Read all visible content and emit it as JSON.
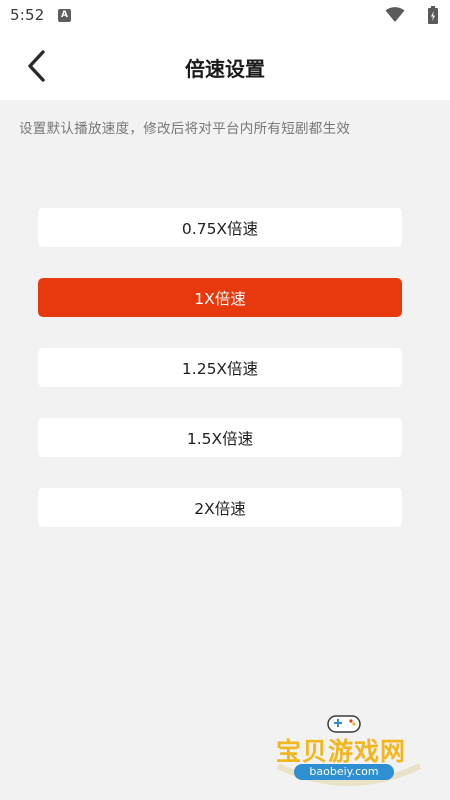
{
  "status_bar": {
    "time": "5:52",
    "app_icon_glyph": "A",
    "wifi_icon": "wifi-icon",
    "battery_icon": "battery-icon"
  },
  "header": {
    "title": "倍速设置",
    "back_icon": "chevron-left-icon"
  },
  "hint": "设置默认播放速度，修改后将对平台内所有短剧都生效",
  "options": [
    {
      "label": "0.75X倍速",
      "selected": false
    },
    {
      "label": "1X倍速",
      "selected": true
    },
    {
      "label": "1.25X倍速",
      "selected": false
    },
    {
      "label": "1.5X倍速",
      "selected": false
    },
    {
      "label": "2X倍速",
      "selected": false
    }
  ],
  "colors": {
    "accent": "#e8390e",
    "background": "#f2f2f2",
    "card": "#ffffff"
  },
  "watermark": {
    "text": "宝贝游戏网",
    "url": "baobeiy.com"
  }
}
